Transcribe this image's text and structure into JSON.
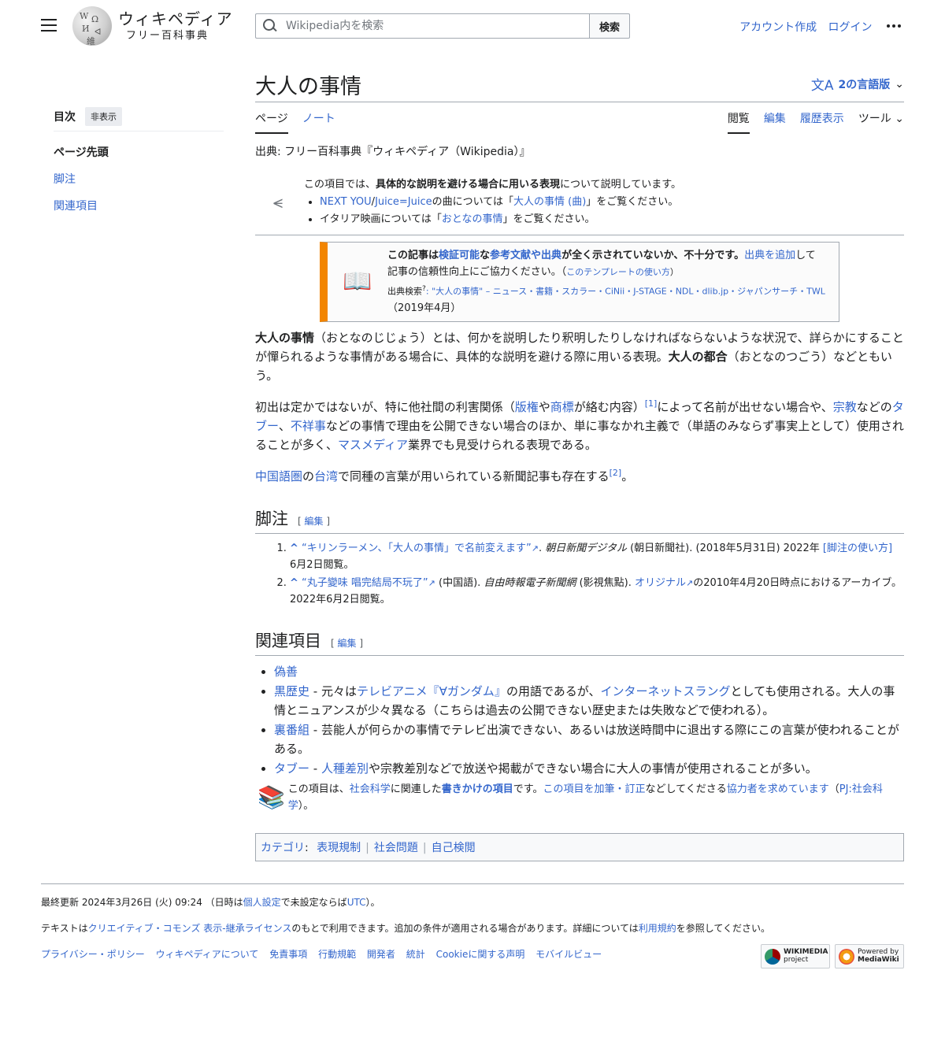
{
  "header": {
    "wordmark": "ウィキペディア",
    "tagline": "フリー百科事典",
    "search_placeholder": "Wikipedia内を検索",
    "search_button": "検索",
    "create_account": "アカウント作成",
    "login": "ログイン"
  },
  "toc": {
    "title": "目次",
    "hide": "非表示",
    "items": [
      "ページ先頭",
      "脚注",
      "関連項目"
    ]
  },
  "page": {
    "title": "大人の事情",
    "languages": "2の言語版",
    "tabs_left": [
      "ページ",
      "ノート"
    ],
    "tabs_right": [
      "閲覧",
      "編集",
      "履歴表示",
      "ツール"
    ],
    "from": "出典: フリー百科事典『ウィキペディア（Wikipedia）』"
  },
  "hatnote": {
    "intro_pre": "この項目では、",
    "intro_bold": "具体的な説明を避ける場合に用いる表現",
    "intro_post": "について説明しています。",
    "item1_link1": "NEXT YOU",
    "item1_slash": "/",
    "item1_link2": "Juice=Juice",
    "item1_mid": "の曲については「",
    "item1_link3": "大人の事情 (曲)",
    "item1_post": "」をご覧ください。",
    "item2_pre": "イタリア映画については「",
    "item2_link": "おとなの事情",
    "item2_post": "」をご覧ください。"
  },
  "ambox": {
    "b1": "この記事は",
    "l1": "検証可能",
    "b2": "な",
    "l2": "参考文献や出典",
    "b3": "が全く示されていないか、不十分です。",
    "l3": "出典を追加",
    "t1": "して",
    "t2": "記事の信頼性向上にご協力ください。（",
    "l4": "このテンプレートの使い方",
    "t3": "）",
    "search_label": "出典検索",
    "search_q": "?",
    "search_links": ": \"大人の事情\" – ニュース・書籍・スカラー・CiNii・J-STAGE・NDL・dlib.jp・ジャパンサーチ・TWL",
    "date": "（2019年4月）"
  },
  "body": {
    "p1_bold1": "大人の事情",
    "p1_t1": "（おとなのじじょう）とは、何かを説明したり釈明したりしなければならないような状況で、詳らかにすることが憚られるような事情がある場合に、具体的な説明を避ける際に用いる表現。",
    "p1_bold2": "大人の都合",
    "p1_t2": "（おとなのつごう）などともいう。",
    "p2_t1": "初出は定かではないが、特に他社間の利害関係（",
    "p2_l1": "版権",
    "p2_t2": "や",
    "p2_l2": "商標",
    "p2_t3": "が絡む内容）",
    "p2_ref": "[1]",
    "p2_t4": "によって名前が出せない場合や、",
    "p2_l3": "宗教",
    "p2_t5": "などの",
    "p2_l4": "タブー",
    "p2_t6": "、",
    "p2_l5": "不祥事",
    "p2_t7": "などの事情で理由を公開できない場合のほか、単に事なかれ主義で（単語のみならず事実上として）使用されることが多く、",
    "p2_l6": "マスメディア",
    "p2_t8": "業界でも見受けられる表現である。",
    "p3_l1": "中国語圏",
    "p3_t1": "の",
    "p3_l2": "台湾",
    "p3_t2": "で同種の言葉が用いられている新聞記事も存在する",
    "p3_ref": "[2]",
    "p3_t3": "。"
  },
  "notes": {
    "heading": "脚注",
    "edit": "編集",
    "edit_open": "[",
    "edit_close": "]",
    "ref1_caret": "^",
    "ref1_link": "“キリンラーメン、「大人の事情」で名前変えます”",
    "ref1_ext": "↗",
    "ref1_pub": "朝日新聞デジタル",
    "ref1_t": " (朝日新聞社). (2018年5月31日) 2022年",
    "ref1_l2": "[脚注の使い方]",
    "ref1_t2": "6月2日閲覧。",
    "ref2_caret": "^",
    "ref2_link": "“丸子變味 唱完結局不玩了”",
    "ref2_ext": "↗",
    "ref2_t1": " (中国語). ",
    "ref2_pub": "自由時報電子新聞網",
    "ref2_t2": " (影視焦點). ",
    "ref2_l2": "オリジナル",
    "ref2_t3": "の2010年4月20日時点におけるアーカイブ。 2022年6月2日閲覧。"
  },
  "see_also": {
    "heading": "関連項目",
    "edit": "編集",
    "i1": "偽善",
    "i2_l1": "黒歴史",
    "i2_t1": " - 元々は",
    "i2_l2": "テレビアニメ『∀ガンダム』",
    "i2_t2": "の用語であるが、",
    "i2_l3": "インターネットスラング",
    "i2_t3": "としても使用される。大人の事情とニュアンスが少々異なる（こちらは過去の公開できない歴史または失敗などで使われる）。",
    "i3_l1": "裏番組",
    "i3_t1": " - 芸能人が何らかの事情でテレビ出演できない、あるいは放送時間中に退出する際にこの言葉が使われることがある。",
    "i4_l1": "タブー",
    "i4_t1": " - ",
    "i4_l2": "人種差別",
    "i4_t2": "や宗教差別などで放送や掲載ができない場合に大人の事情が使用されることが多い。"
  },
  "stub": {
    "t1": "この項目は、",
    "l1": "社会科学",
    "t2": "に関連した",
    "l2": "書きかけの項目",
    "t3": "です。",
    "l3": "この項目を加筆・訂正",
    "t4": "などしてくださる",
    "l4": "協力者を求めています",
    "t5": "（",
    "l5": "PJ:社会科学",
    "t6": "）。"
  },
  "categories": {
    "label": "カテゴリ",
    "colon": ":",
    "items": [
      "表現規制",
      "社会問題",
      "自己検閲"
    ]
  },
  "footer": {
    "updated_pre": "最終更新 2024年3月26日 (火) 09:24 （日時は",
    "updated_l1": "個人設定",
    "updated_mid": "で未設定ならば",
    "updated_l2": "UTC",
    "updated_post": "）。",
    "license_pre": "テキストは",
    "license_l1": "クリエイティブ・コモンズ 表示-継承ライセンス",
    "license_mid": "のもとで利用できます。追加の条件が適用される場合があります。詳細については",
    "license_l2": "利用規約",
    "license_post": "を参照してください。",
    "links": [
      "プライバシー・ポリシー",
      "ウィキペディアについて",
      "免責事項",
      "行動規範",
      "開発者",
      "統計",
      "Cookieに関する声明",
      "モバイルビュー"
    ],
    "badge1_top": "WIKIMEDIA",
    "badge1_bottom": "project",
    "badge2_top": "Powered by",
    "badge2_bottom": "MediaWiki"
  },
  "colors": {
    "link": "#3366cc",
    "ambox_border": "#f28500"
  }
}
